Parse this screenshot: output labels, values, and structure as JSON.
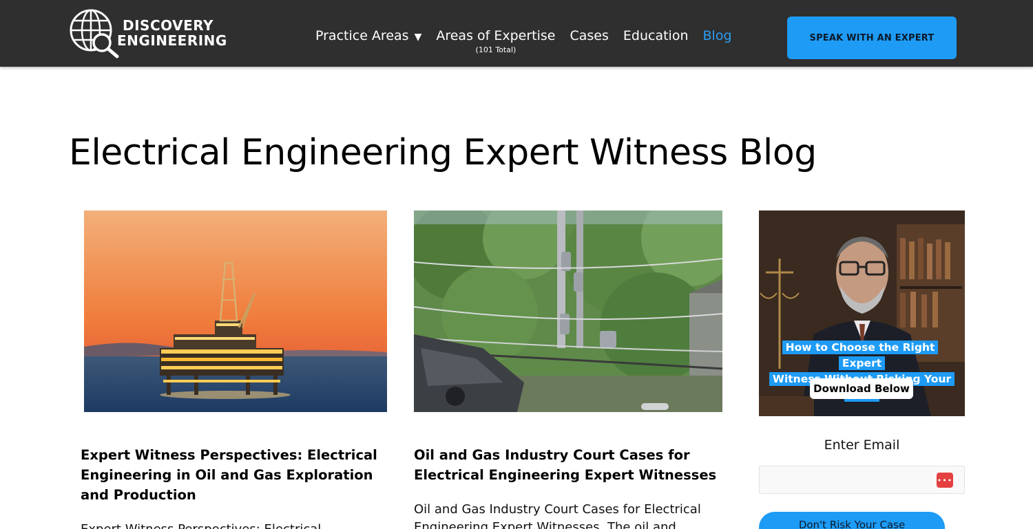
{
  "header": {
    "logo": {
      "line1": "DISCOVERY",
      "line2": "ENGINEERING"
    },
    "nav": [
      {
        "label": "Practice Areas",
        "caret": "▼"
      },
      {
        "label": "Areas of Expertise",
        "sub": "(101 Total)"
      },
      {
        "label": "Cases"
      },
      {
        "label": "Education"
      },
      {
        "label": "Blog",
        "active": true
      }
    ],
    "cta_label": "SPEAK WITH AN EXPERT"
  },
  "page": {
    "title": "Electrical Engineering Expert Witness Blog"
  },
  "posts": [
    {
      "title": "Expert Witness Perspectives: Electrical Engineering in Oil and Gas Exploration and Production",
      "excerpt": "Expert Witness Perspectives: Electrical"
    },
    {
      "title": "Oil and Gas Industry Court Cases for Electrical Engineering Expert Witnesses",
      "excerpt": "Oil and Gas Industry Court Cases for Electrical Engineering Expert Witnesses. The oil and"
    }
  ],
  "sidebar": {
    "promo": {
      "headline_line1": "How to Choose the Right Expert",
      "headline_line2": "Witness Without Risking Your Case",
      "download_label": "Download Below"
    },
    "email_label": "Enter Email",
    "email_value": "",
    "submit_label": "Don't Risk Your Case"
  },
  "colors": {
    "header_bg": "#2f2f2f",
    "accent": "#1e9bf5",
    "active_nav": "#2a9df4"
  }
}
